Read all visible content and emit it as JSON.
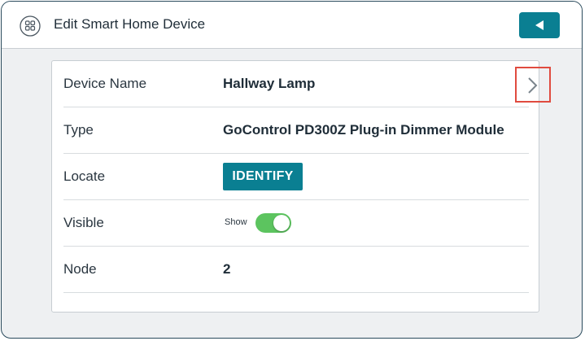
{
  "header": {
    "title": "Edit Smart Home Device",
    "app_icon": "device-grid-icon",
    "back_icon": "back-arrow-icon"
  },
  "rows": [
    {
      "label": "Device Name",
      "value": "Hallway Lamp",
      "action_icon": "chevron-right-icon"
    },
    {
      "label": "Type",
      "value": "GoControl PD300Z Plug-in Dimmer Module"
    },
    {
      "label": "Locate",
      "button_label": "IDENTIFY"
    },
    {
      "label": "Visible",
      "toggle_label": "Show",
      "toggle_on": true
    },
    {
      "label": "Node",
      "value": "2"
    }
  ],
  "colors": {
    "accent": "#0a7f92",
    "toggle_on": "#5cc45f",
    "highlight_border": "#e04b3f"
  }
}
